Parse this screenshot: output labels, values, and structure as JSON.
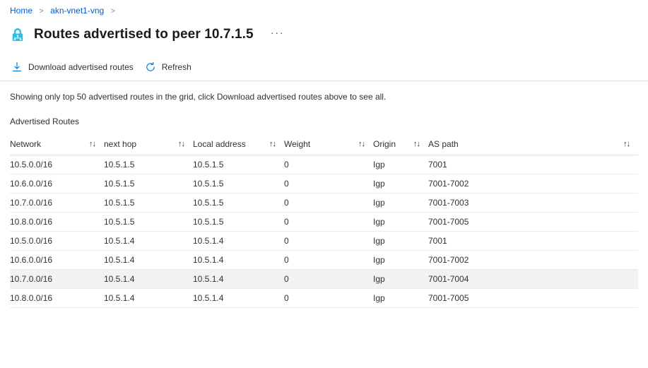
{
  "breadcrumb": {
    "items": [
      {
        "label": "Home",
        "link": true
      },
      {
        "label": "akn-vnet1-vng",
        "link": true
      }
    ],
    "separator": ">"
  },
  "header": {
    "icon": "vpn-gateway-padlock-icon",
    "title": "Routes advertised to peer 10.7.1.5",
    "more_label": "···"
  },
  "toolbar": {
    "buttons": [
      {
        "label": "Download advertised routes",
        "icon": "download-icon"
      },
      {
        "label": "Refresh",
        "icon": "refresh-icon"
      }
    ]
  },
  "info": {
    "message": "Showing only top 50 advertised routes in the grid, click Download advertised routes above to see all."
  },
  "grid": {
    "caption": "Advertised Routes",
    "sort_glyph": "↑↓",
    "columns": [
      {
        "key": "network",
        "label": "Network",
        "sortable": true
      },
      {
        "key": "next_hop",
        "label": "next hop",
        "sortable": true
      },
      {
        "key": "local_address",
        "label": "Local address",
        "sortable": true
      },
      {
        "key": "weight",
        "label": "Weight",
        "sortable": true
      },
      {
        "key": "origin",
        "label": "Origin",
        "sortable": true
      },
      {
        "key": "as_path",
        "label": "AS path",
        "sortable": true
      }
    ],
    "rows": [
      {
        "network": "10.5.0.0/16",
        "next_hop": "10.5.1.5",
        "local_address": "10.5.1.5",
        "weight": "0",
        "origin": "Igp",
        "as_path": "7001",
        "hovered": false
      },
      {
        "network": "10.6.0.0/16",
        "next_hop": "10.5.1.5",
        "local_address": "10.5.1.5",
        "weight": "0",
        "origin": "Igp",
        "as_path": "7001-7002",
        "hovered": false
      },
      {
        "network": "10.7.0.0/16",
        "next_hop": "10.5.1.5",
        "local_address": "10.5.1.5",
        "weight": "0",
        "origin": "Igp",
        "as_path": "7001-7003",
        "hovered": false
      },
      {
        "network": "10.8.0.0/16",
        "next_hop": "10.5.1.5",
        "local_address": "10.5.1.5",
        "weight": "0",
        "origin": "Igp",
        "as_path": "7001-7005",
        "hovered": false
      },
      {
        "network": "10.5.0.0/16",
        "next_hop": "10.5.1.4",
        "local_address": "10.5.1.4",
        "weight": "0",
        "origin": "Igp",
        "as_path": "7001",
        "hovered": false
      },
      {
        "network": "10.6.0.0/16",
        "next_hop": "10.5.1.4",
        "local_address": "10.5.1.4",
        "weight": "0",
        "origin": "Igp",
        "as_path": "7001-7002",
        "hovered": false
      },
      {
        "network": "10.7.0.0/16",
        "next_hop": "10.5.1.4",
        "local_address": "10.5.1.4",
        "weight": "0",
        "origin": "Igp",
        "as_path": "7001-7004",
        "hovered": true
      },
      {
        "network": "10.8.0.0/16",
        "next_hop": "10.5.1.4",
        "local_address": "10.5.1.4",
        "weight": "0",
        "origin": "Igp",
        "as_path": "7001-7005",
        "hovered": false
      }
    ]
  },
  "colors": {
    "link": "#015cda",
    "accent": "#0078d4",
    "icon_cyan": "#32bedd",
    "row_hover": "#f3f2f1",
    "row_border": "#edebe9",
    "header_border": "#e1dfdd",
    "text": "#323130"
  }
}
